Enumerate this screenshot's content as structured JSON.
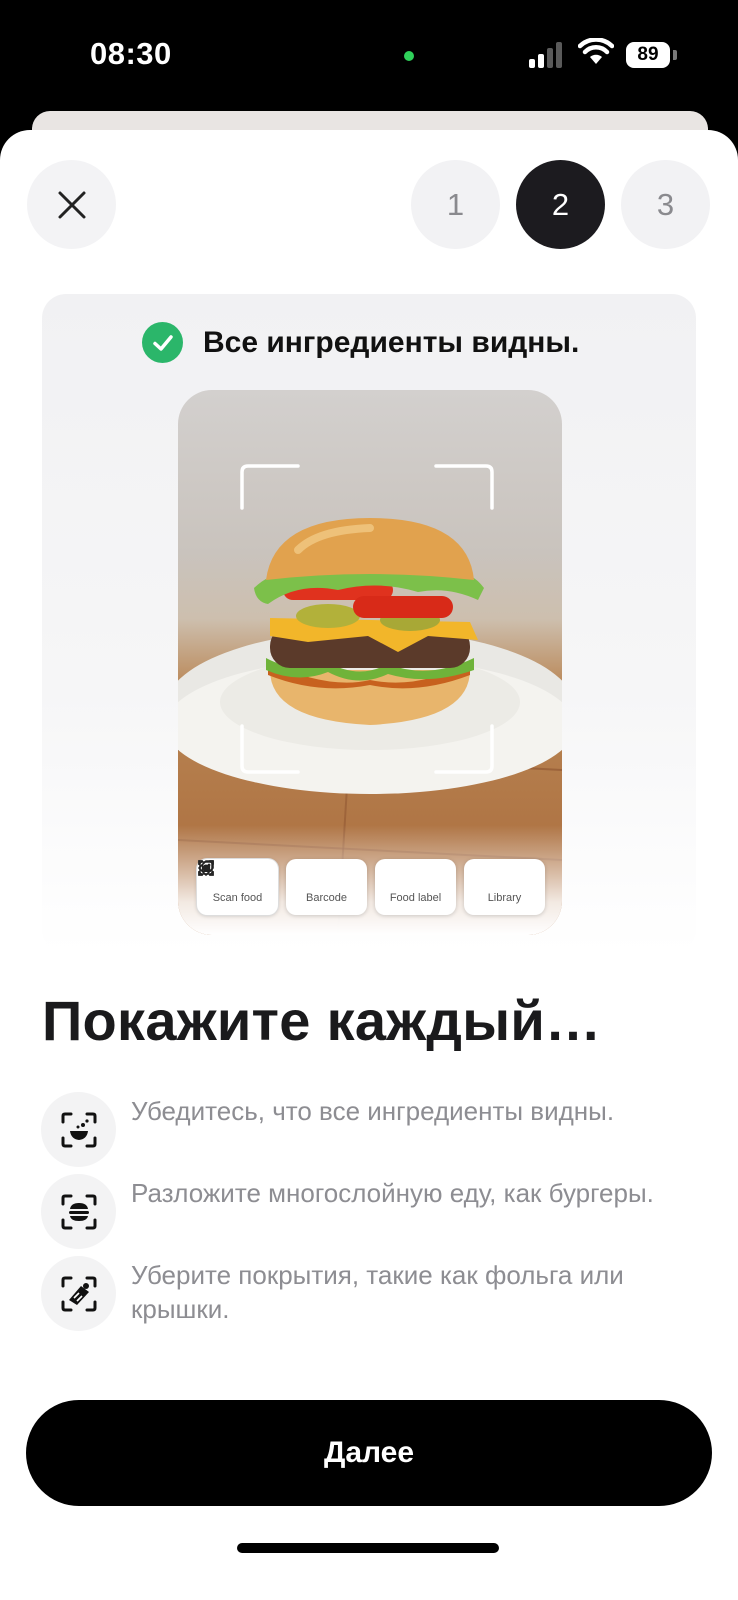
{
  "status_bar": {
    "time": "08:30",
    "battery": "89"
  },
  "steps": [
    "1",
    "2",
    "3"
  ],
  "active_step": "2",
  "preview": {
    "check_text": "Все ингредиенты видны.",
    "modes": [
      {
        "icon": "scan-food-icon",
        "label": "Scan food"
      },
      {
        "icon": "barcode-icon",
        "label": "Barcode"
      },
      {
        "icon": "food-label-icon",
        "label": "Food label"
      },
      {
        "icon": "library-icon",
        "label": "Library"
      }
    ]
  },
  "heading": "Покажите каждый…",
  "tips": [
    {
      "icon": "ingredients-scan-icon",
      "text": "Убедитесь, что все ингредиенты видны."
    },
    {
      "icon": "burger-scan-icon",
      "text": "Разложите многослойную еду, как бургеры."
    },
    {
      "icon": "wrapped-food-scan-icon",
      "text": "Уберите покрытия, такие как фольга или крышки."
    }
  ],
  "next_button": "Далее",
  "colors": {
    "accent_green": "#2bb66a",
    "active_step": "#1c1b1f",
    "button": "#000000"
  }
}
